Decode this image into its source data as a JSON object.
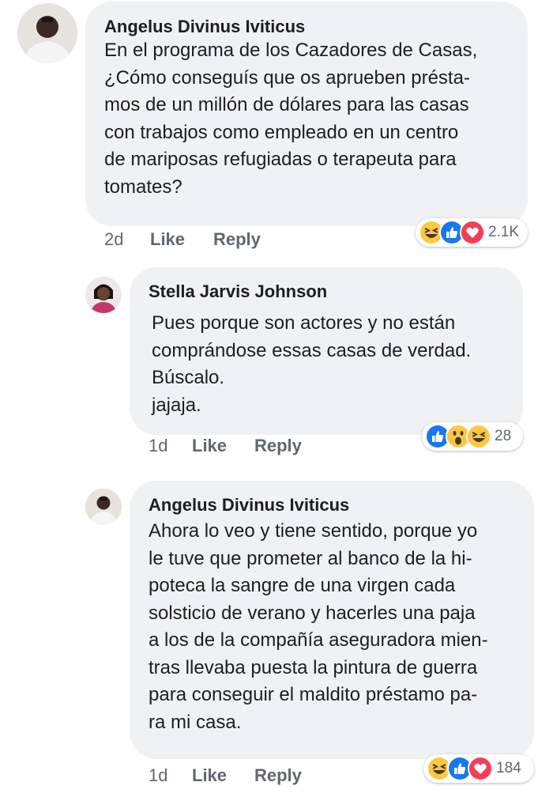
{
  "comments": [
    {
      "author": "Angelus Divinus Iviticus",
      "text": "En el programa de los Cazadores de Casas,\n¿Cómo conseguís que os aprueben présta-\nmos de un millón de dólares para las casas\ncon trabajos como empleado en un centro\nde mariposas refugiadas o terapeuta para\ntomates?",
      "time": "2d",
      "like": "Like",
      "reply": "Reply",
      "reactions": [
        "haha-icon",
        "like-icon",
        "love-icon"
      ],
      "reaction_count": "2.1K"
    },
    {
      "author": "Stella Jarvis Johnson",
      "text": "Pues porque son actores y no están\ncomprándose essas casas de verdad.\nBúscalo.\njajaja.",
      "time": "1d",
      "like": "Like",
      "reply": "Reply",
      "reactions": [
        "like-icon",
        "wow-icon",
        "haha-icon"
      ],
      "reaction_count": "28"
    },
    {
      "author": "Angelus Divinus Iviticus",
      "text": "Ahora lo veo y tiene sentido, porque yo\nle tuve que prometer al banco de la hi-\npoteca la sangre de una virgen cada\nsolsticio de verano y hacerles una paja\na los de la compañía aseguradora mien-\ntras llevaba puesta la pintura de guerra\npara conseguir el maldito préstamo pa-\nra mi casa.",
      "time": "1d",
      "like": "Like",
      "reply": "Reply",
      "reactions": [
        "haha-icon",
        "like-icon",
        "love-icon"
      ],
      "reaction_count": "184"
    }
  ],
  "colors": {
    "bubble": "#f0f1f3",
    "meta_text": "#606770",
    "like_blue": "#1877f2",
    "love_red": "#f33e58",
    "emoji_yellow": "#fcc844"
  }
}
